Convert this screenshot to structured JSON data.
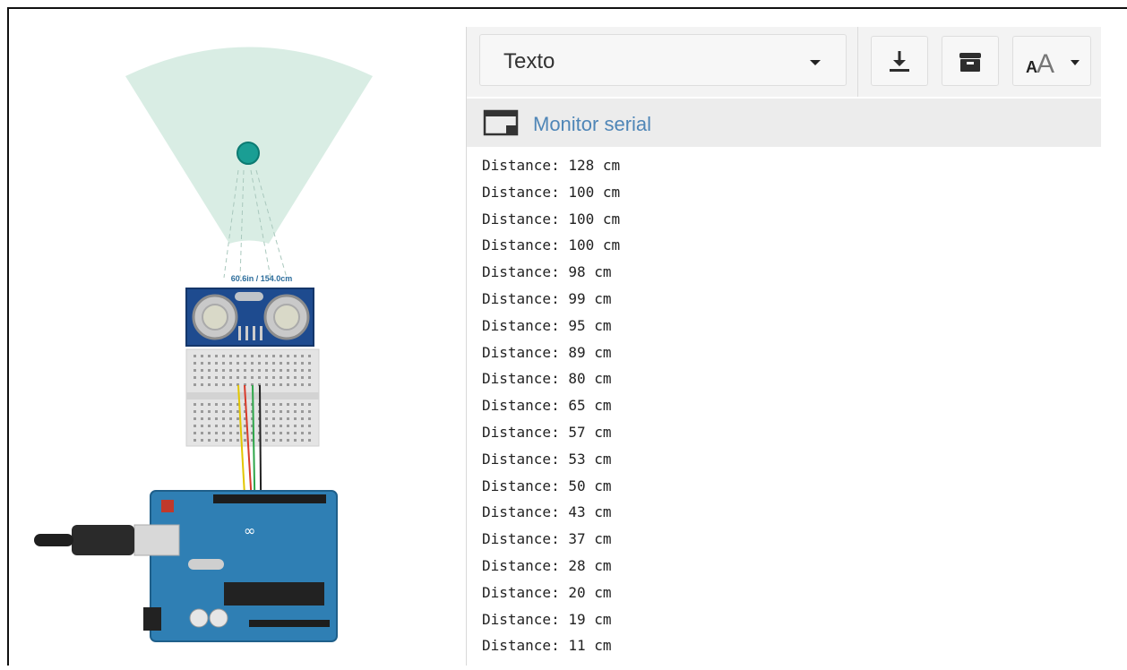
{
  "circuit": {
    "range_label": "60.6in / 154.0cm"
  },
  "toolbar": {
    "mode_select": {
      "selected": "Texto"
    },
    "download_icon": "download-icon",
    "clear_icon": "archive-icon",
    "font_size_icon": "font-size-icon"
  },
  "monitor": {
    "title": "Monitor serial",
    "icon": "monitor-window-icon",
    "lines": [
      "Distance: 128 cm",
      "Distance: 100 cm",
      "Distance: 100 cm",
      "Distance: 100 cm",
      "Distance: 98 cm",
      "Distance: 99 cm",
      "Distance: 95 cm",
      "Distance: 89 cm",
      "Distance: 80 cm",
      "Distance: 65 cm",
      "Distance: 57 cm",
      "Distance: 53 cm",
      "Distance: 50 cm",
      "Distance: 43 cm",
      "Distance: 37 cm",
      "Distance: 28 cm",
      "Distance: 20 cm",
      "Distance: 19 cm",
      "Distance: 11 cm"
    ]
  }
}
